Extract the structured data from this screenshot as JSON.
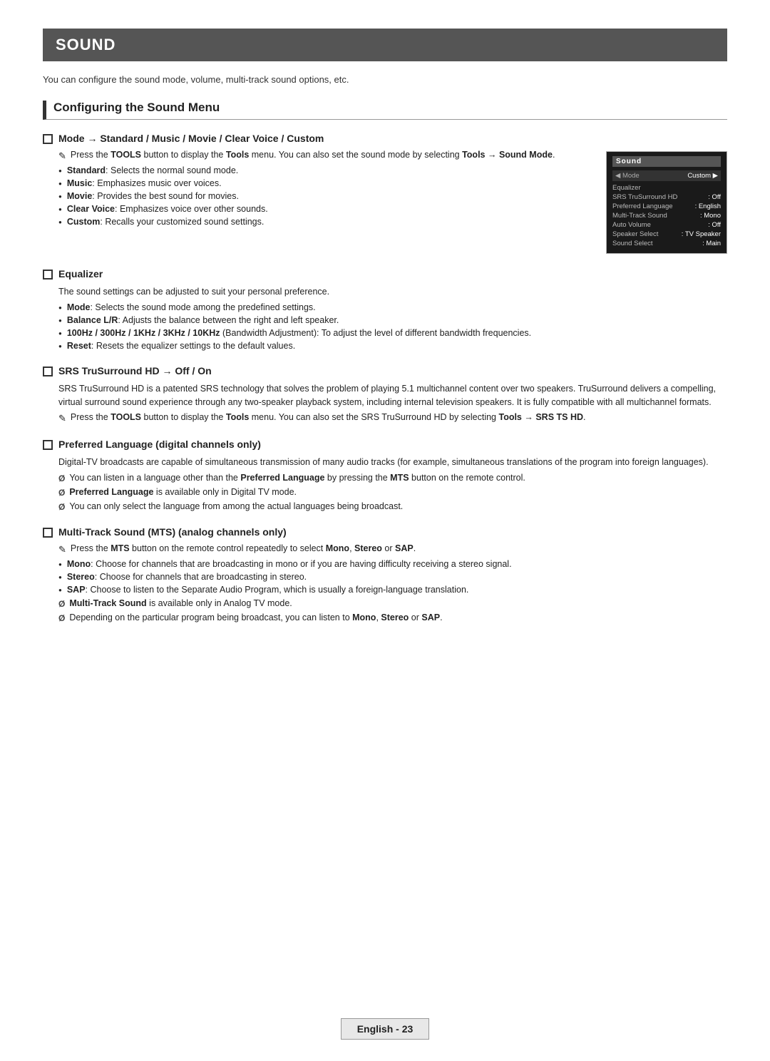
{
  "page": {
    "title": "SOUND",
    "intro": "You can configure the sound mode, volume, multi-track sound options, etc.",
    "section_heading": "Configuring the Sound Menu",
    "footer_label": "English - 23"
  },
  "subsections": [
    {
      "id": "mode",
      "title": "Mode → Standard / Music / Movie / Clear Voice / Custom",
      "has_image": true,
      "notes": [
        {
          "type": "pencil",
          "text": "Press the TOOLS button to display the Tools menu. You can also set the sound mode by selecting Tools → Sound Mode."
        }
      ],
      "bullets": [
        {
          "text": "Standard: Selects the normal sound mode."
        },
        {
          "text": "Music: Emphasizes music over voices."
        },
        {
          "text": "Movie: Provides the best sound for movies."
        },
        {
          "text": "Clear Voice: Emphasizes voice over other sounds."
        },
        {
          "text": "Custom: Recalls your customized sound settings."
        }
      ],
      "screen": {
        "title_bar": "Sound",
        "mode_label": "Mode",
        "mode_value": "Custom",
        "rows": [
          {
            "label": "Equalizer",
            "value": ""
          },
          {
            "label": "SRS TruSurround HD",
            "value": ": Off"
          },
          {
            "label": "Preferred Language",
            "value": ": English"
          },
          {
            "label": "Multi-Track Sound",
            "value": ": Mono"
          },
          {
            "label": "Auto Volume",
            "value": ": Off"
          },
          {
            "label": "Speaker Select",
            "value": ": TV Speaker"
          },
          {
            "label": "Sound Select",
            "value": ": Main"
          }
        ]
      }
    },
    {
      "id": "equalizer",
      "title": "Equalizer",
      "has_image": false,
      "intro_text": "The sound settings can be adjusted to suit your personal preference.",
      "bullets": [
        {
          "text": "Mode: Selects the sound mode among the predefined settings."
        },
        {
          "text": "Balance L/R: Adjusts the balance between the right and left speaker."
        },
        {
          "text": "100Hz / 300Hz / 1KHz / 3KHz / 10KHz (Bandwidth Adjustment): To adjust the level of different bandwidth frequencies."
        },
        {
          "text": "Reset: Resets the equalizer settings to the default values."
        }
      ]
    },
    {
      "id": "srs",
      "title": "SRS TruSurround HD → Off / On",
      "has_image": false,
      "para_text": "SRS TruSurround HD is a patented SRS technology that solves the problem of playing 5.1 multichannel content over two speakers. TruSurround delivers a compelling, virtual surround sound experience through any two-speaker playback system, including internal television speakers. It is fully compatible with all multichannel formats.",
      "notes": [
        {
          "type": "pencil",
          "text": "Press the TOOLS button to display the Tools menu. You can also set the SRS TruSurround HD by selecting Tools → SRS TS HD."
        }
      ]
    },
    {
      "id": "preferred_language",
      "title": "Preferred Language (digital channels only)",
      "has_image": false,
      "para_text": "Digital-TV broadcasts are capable of simultaneous transmission of many audio tracks (for example, simultaneous translations of the program into foreign languages).",
      "info_notes": [
        {
          "text": "You can listen in a language other than the Preferred Language by pressing the MTS button on the remote control."
        },
        {
          "text": "Preferred Language is available only in Digital TV mode."
        },
        {
          "text": "You can only select the language from among the actual languages being broadcast."
        }
      ]
    },
    {
      "id": "multi_track",
      "title": "Multi-Track Sound (MTS) (analog channels only)",
      "has_image": false,
      "notes_pencil": [
        {
          "text": "Press the MTS button on the remote control repeatedly to select Mono, Stereo or SAP."
        }
      ],
      "bullets": [
        {
          "text": "Mono: Choose for channels that are broadcasting in mono or if you are having difficulty receiving a stereo signal."
        },
        {
          "text": "Stereo: Choose for channels that are broadcasting in stereo."
        },
        {
          "text": "SAP: Choose to listen to the Separate Audio Program, which is usually a foreign-language translation."
        }
      ],
      "info_notes": [
        {
          "text": "Multi-Track Sound is available only in Analog TV mode."
        },
        {
          "text": "Depending on the particular program being broadcast, you can listen to Mono, Stereo or SAP."
        }
      ]
    }
  ]
}
